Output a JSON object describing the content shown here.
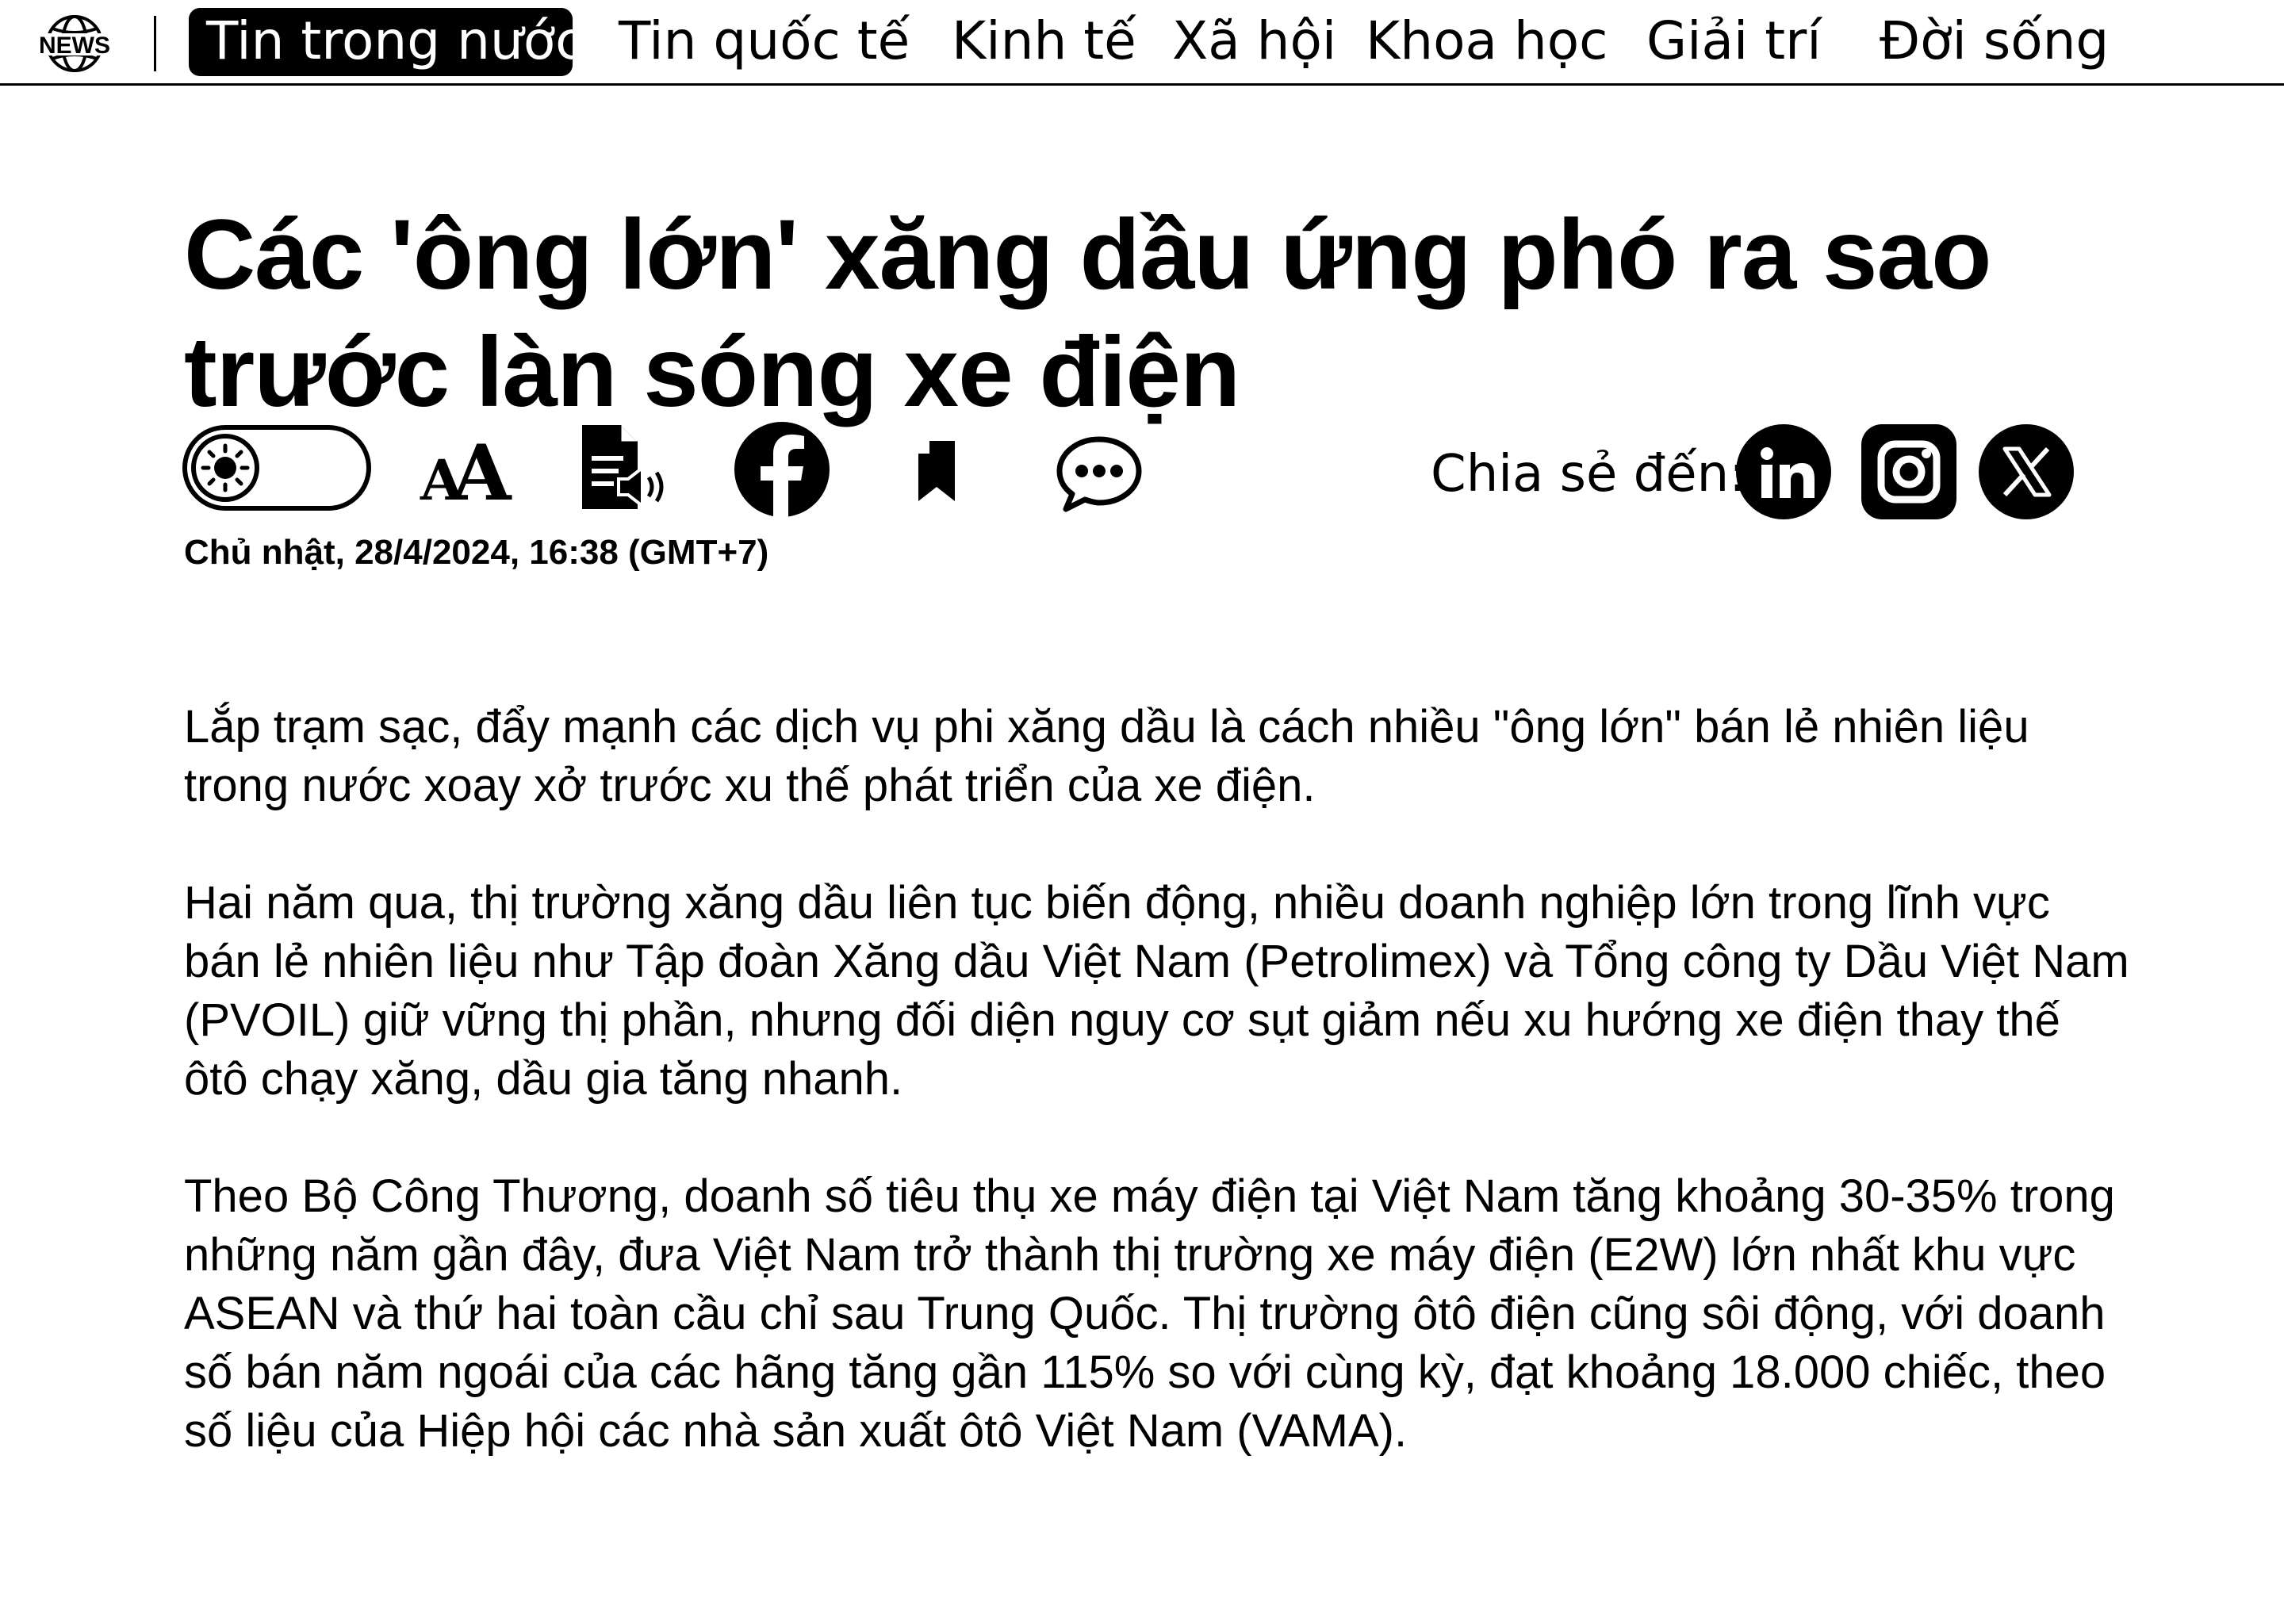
{
  "nav": {
    "logo_text": "NEWS",
    "items": [
      {
        "label": "Tin trong nước",
        "active": true
      },
      {
        "label": "Tin quốc tế"
      },
      {
        "label": "Kinh tế"
      },
      {
        "label": "Xã hội"
      },
      {
        "label": "Khoa học"
      },
      {
        "label": "Giải trí"
      },
      {
        "label": "Đời sống"
      }
    ]
  },
  "article": {
    "headline": "Các 'ông lớn' xăng dầu ứng phó ra sao trước làn sóng xe điện",
    "toolbar": {
      "theme_toggle_icon": "sun-toggle-icon",
      "font_size_icon": "font-size-icon",
      "font_size_glyph": "A",
      "audio_icon": "text-to-speech-icon",
      "facebook_icon": "facebook-icon",
      "bookmark_icon": "bookmark-icon",
      "comment_icon": "comment-icon"
    },
    "share": {
      "label": "Chia sẻ đến:",
      "networks": [
        "linkedin-icon",
        "instagram-icon",
        "x-icon"
      ]
    },
    "date": "Chủ nhật, 28/4/2024, 16:38 (GMT+7)",
    "paragraphs": [
      "Lắp trạm sạc, đẩy mạnh các dịch vụ phi xăng dầu là cách nhiều \"ông lớn\" bán lẻ nhiên liệu trong nước xoay xở trước xu thế phát triển của xe điện.",
      "Hai năm qua, thị trường xăng dầu liên tục biến động, nhiều doanh nghiệp lớn trong lĩnh vực bán lẻ nhiên liệu như Tập đoàn Xăng dầu Việt Nam (Petrolimex) và Tổng công ty Dầu Việt Nam (PVOIL) giữ vững thị phần, nhưng đối diện nguy cơ sụt giảm nếu xu hướng xe điện thay thế ôtô chạy xăng, dầu gia tăng nhanh.",
      "Theo Bộ Công Thương, doanh số tiêu thụ xe máy điện tại Việt Nam tăng khoảng 30-35% trong những năm gần đây, đưa Việt Nam trở thành thị trường xe máy điện (E2W) lớn nhất khu vực ASEAN và thứ hai toàn cầu chỉ sau Trung Quốc. Thị trường ôtô điện cũng sôi động, với doanh số bán năm ngoái của các hãng tăng gần 115% so với cùng kỳ, đạt khoảng 18.000 chiếc, theo số liệu của Hiệp hội các nhà sản xuất ôtô Việt Nam (VAMA)."
    ]
  }
}
